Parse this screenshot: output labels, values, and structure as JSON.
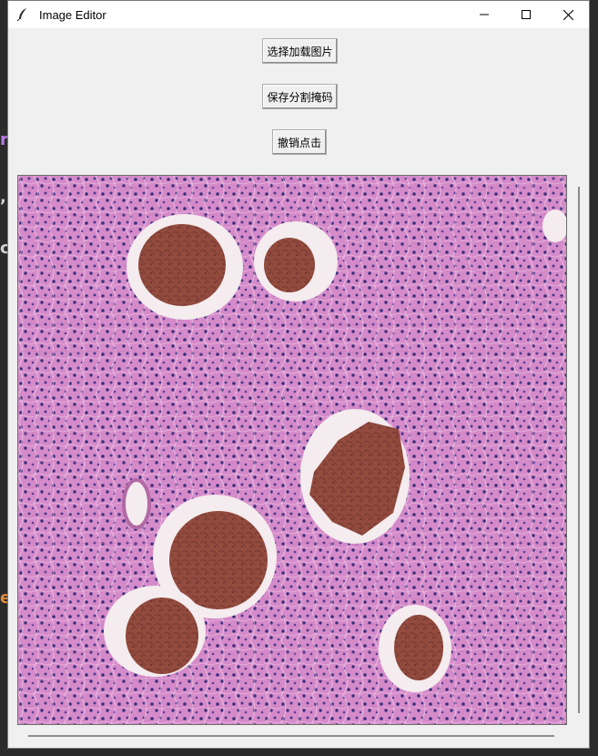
{
  "window": {
    "title": "Image Editor",
    "icon": "feather-icon"
  },
  "buttons": {
    "load": "选择加载图片",
    "save": "保存分割掩码",
    "undo": "撤销点击"
  },
  "background_letters": [
    "r",
    ",",
    "c",
    "e"
  ],
  "colors": {
    "tissue": "#d58ac9",
    "mask": "#8a3d2e",
    "capsule": "#f4ecee"
  }
}
